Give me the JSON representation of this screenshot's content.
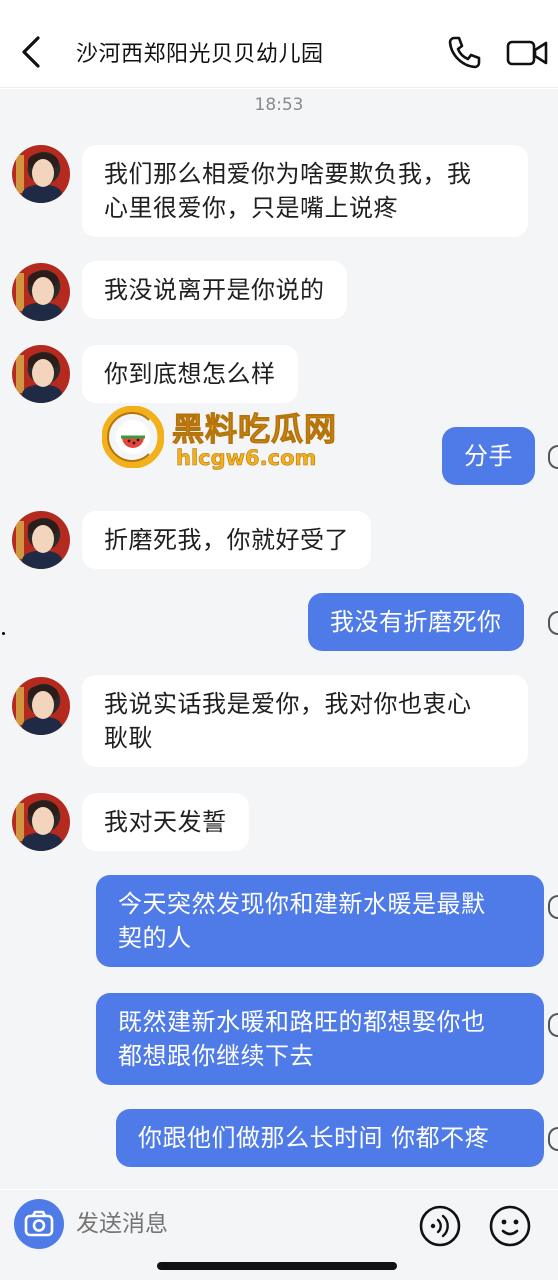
{
  "header": {
    "title": "沙河西郑阳光贝贝幼儿园",
    "icons": [
      "chevron-left-icon",
      "phone-icon",
      "video-icon"
    ]
  },
  "chat": {
    "time": "18:53",
    "messages": [
      {
        "side": "in",
        "line1": "我们那么相爱你为啥要欺负我，我",
        "line2": "心里很爱你，只是嘴上说疼"
      },
      {
        "side": "in",
        "line1": "我没说离开是你说的"
      },
      {
        "side": "in",
        "line1": "你到底想怎么样"
      },
      {
        "side": "out",
        "line1": "分手"
      },
      {
        "side": "in",
        "line1": "折磨死我，你就好受了"
      },
      {
        "side": "out",
        "line1": "我没有折磨死你"
      },
      {
        "side": "in",
        "line1": "我说实话我是爱你，我对你也衷心",
        "line2": "耿耿"
      },
      {
        "side": "in",
        "line1": "我对天发誓"
      },
      {
        "side": "out",
        "line1": "今天突然发现你和建新水暖是最默",
        "line2": "契的人"
      },
      {
        "side": "out",
        "line1": "既然建新水暖和路旺的都想娶你也",
        "line2": "都想跟你继续下去"
      },
      {
        "side": "out",
        "line1": "你跟他们做那么长时间 你都不疼"
      }
    ]
  },
  "watermark": {
    "title": "黑料吃瓜网",
    "url": "hlcgw6.com"
  },
  "input": {
    "placeholder": "发送消息",
    "icons": [
      "camera-icon",
      "voice-icon",
      "emoji-icon"
    ]
  },
  "colors": {
    "accent": "#4f7be8",
    "chat_bg": "#f4f5f7",
    "bubble_in": "#ffffff",
    "watermark": "#f2b11a"
  }
}
